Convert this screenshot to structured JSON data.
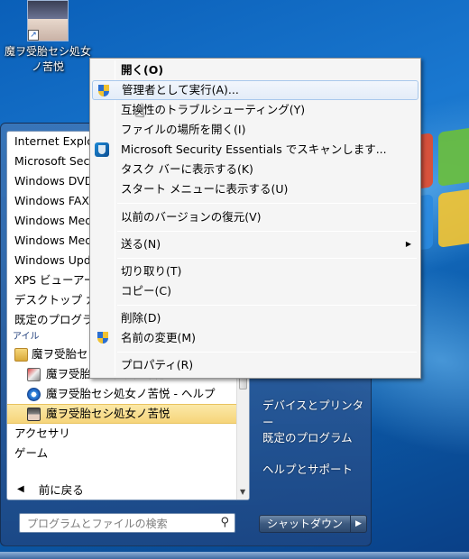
{
  "desktop_icon": {
    "label_line1": "魔ヲ受胎セシ処女",
    "label_line2": "ノ苦悦"
  },
  "start_menu": {
    "programs": [
      "Internet Explorer",
      "Microsoft Security Essentials",
      "Windows DVD Maker",
      "Windows FAX とスキャン",
      "Windows Media Center",
      "Windows Media Player",
      "Windows Update",
      "XPS ビューアー",
      "デスクトップ ガジェット ギャラリー",
      "既定のプログラム"
    ],
    "category_label": "アイル",
    "folder_label": "魔ヲ受胎セシ処女ノ苦悦",
    "sub_items": [
      "魔ヲ受胎セシ処女ノ苦悦 - アンインストール",
      "魔ヲ受胎セシ処女ノ苦悦 - ヘルプ",
      "魔ヲ受胎セシ処女ノ苦悦"
    ],
    "other_items": [
      "アクセサリ",
      "ゲーム"
    ],
    "back_label": "前に戻る",
    "search_placeholder": "プログラムとファイルの検索",
    "right_items": [
      "デバイスとプリンター",
      "既定のプログラム",
      "ヘルプとサポート"
    ],
    "shutdown_label": "シャットダウン"
  },
  "context_menu": {
    "open": "開く(O)",
    "run_as_admin": "管理者として実行(A)...",
    "troubleshoot": "互換性のトラブルシューティング(Y)",
    "open_location": "ファイルの場所を開く(I)",
    "mse_scan": "Microsoft Security Essentials でスキャンします...",
    "pin_taskbar": "タスク バーに表示する(K)",
    "pin_start": "スタート メニューに表示する(U)",
    "restore_previous": "以前のバージョンの復元(V)",
    "send_to": "送る(N)",
    "cut": "切り取り(T)",
    "copy": "コピー(C)",
    "delete": "削除(D)",
    "rename": "名前の変更(M)",
    "properties": "プロパティ(R)"
  }
}
